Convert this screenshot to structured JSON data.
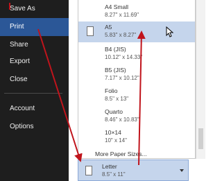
{
  "sidebar": {
    "items": [
      {
        "label": "Save As",
        "selected": false
      },
      {
        "label": "Print",
        "selected": true
      },
      {
        "label": "Share",
        "selected": false
      },
      {
        "label": "Export",
        "selected": false
      },
      {
        "label": "Close",
        "selected": false
      },
      {
        "label": "Account",
        "selected": false
      },
      {
        "label": "Options",
        "selected": false
      }
    ]
  },
  "paper_sizes": {
    "items": [
      {
        "name": "A4 Small",
        "size": "8.27\" x 11.69\"",
        "hovered": false
      },
      {
        "name": "A5",
        "size": "5.83\" x 8.27\"",
        "hovered": true
      },
      {
        "name": "B4 (JIS)",
        "size": "10.12\" x 14.33\"",
        "hovered": false
      },
      {
        "name": "B5 (JIS)",
        "size": "7.17\" x 10.12\"",
        "hovered": false
      },
      {
        "name": "Folio",
        "size": "8.5\" x 13\"",
        "hovered": false
      },
      {
        "name": "Quarto",
        "size": "8.46\" x 10.83\"",
        "hovered": false
      },
      {
        "name": "10×14",
        "size": "10\" x 14\"",
        "hovered": false
      }
    ],
    "more_label": "More Paper Sizes..."
  },
  "selected_paper": {
    "name": "Letter",
    "size": "8.5\" x 11\""
  },
  "icons": {
    "page": "page-icon",
    "cursor": "mouse-pointer-icon",
    "dropdown": "chevron-down-icon"
  },
  "colors": {
    "sidebar_bg": "#1e1e1e",
    "sidebar_selected": "#2b5797",
    "hover_bg": "#c5d5ec",
    "annotation_arrow": "#c0141c"
  }
}
